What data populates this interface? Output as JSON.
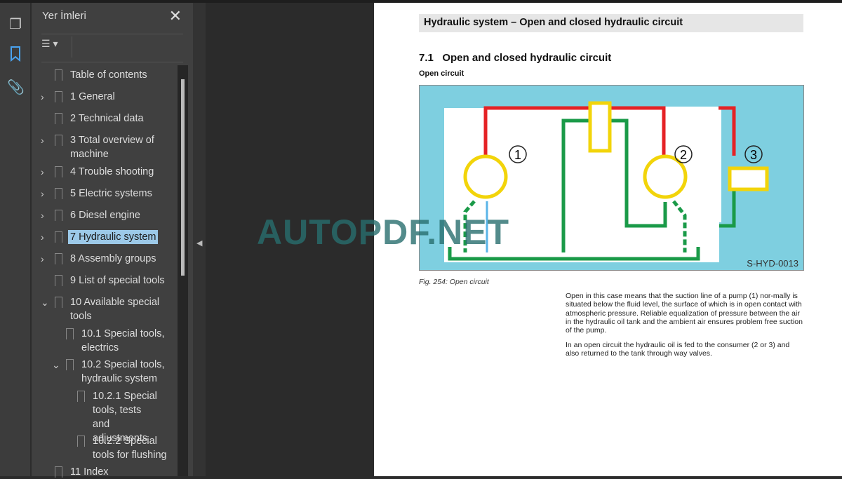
{
  "toolbar": {
    "icons": [
      "pages-icon",
      "bookmark-icon",
      "attachment-icon"
    ],
    "active": "bookmark-icon",
    "accent": "#4aa3f0"
  },
  "panel": {
    "title": "Yer İmleri",
    "close": "✕",
    "options": "☰ ▾",
    "items": [
      {
        "label": "Table of contents",
        "expand": ""
      },
      {
        "label": "1 General",
        "expand": "›"
      },
      {
        "label": "2 Technical data",
        "expand": ""
      },
      {
        "label": "3 Total overview of machine",
        "expand": "›"
      },
      {
        "label": "4 Trouble shooting",
        "expand": "›"
      },
      {
        "label": "5 Electric systems",
        "expand": "›"
      },
      {
        "label": "6 Diesel engine",
        "expand": "›"
      },
      {
        "label": "7 Hydraulic system",
        "expand": "›",
        "selected": true
      },
      {
        "label": "8 Assembly groups",
        "expand": "›"
      },
      {
        "label": "9 List of special tools",
        "expand": ""
      },
      {
        "label": "10 Available special tools",
        "expand": "⌄"
      },
      {
        "label": "10.1 Special tools, electrics",
        "expand": ""
      },
      {
        "label": "10.2 Special tools, hydraulic system",
        "expand": "⌄"
      },
      {
        "label": "10.2.1 Special tools, tests and adjustments",
        "expand": ""
      },
      {
        "label": "10.2.2 Special tools for flushing",
        "expand": ""
      },
      {
        "label": "11 Index",
        "expand": ""
      }
    ]
  },
  "document": {
    "header": "Hydraulic system – Open and closed hydraulic circuit",
    "section": "7.1   Open and closed hydraulic circuit",
    "subsection": "Open circuit",
    "figure_code": "S-HYD-0013",
    "figure_labels": [
      "1",
      "2",
      "3"
    ],
    "caption": "Fig.  254: Open circuit",
    "para1": "Open in this case means that the suction line of a pump (1) nor-mally is situated below the fluid level, the surface of which is in open contact with atmospheric pressure. Reliable equalization of pressure between the air in the hydraulic oil tank and the ambient air ensures problem free suction of the pump.",
    "para2": "In an open circuit the hydraulic oil is fed to the consumer (2 or 3) and also returned to the tank through way valves.",
    "watermark": "AUTOPDF.NET"
  }
}
